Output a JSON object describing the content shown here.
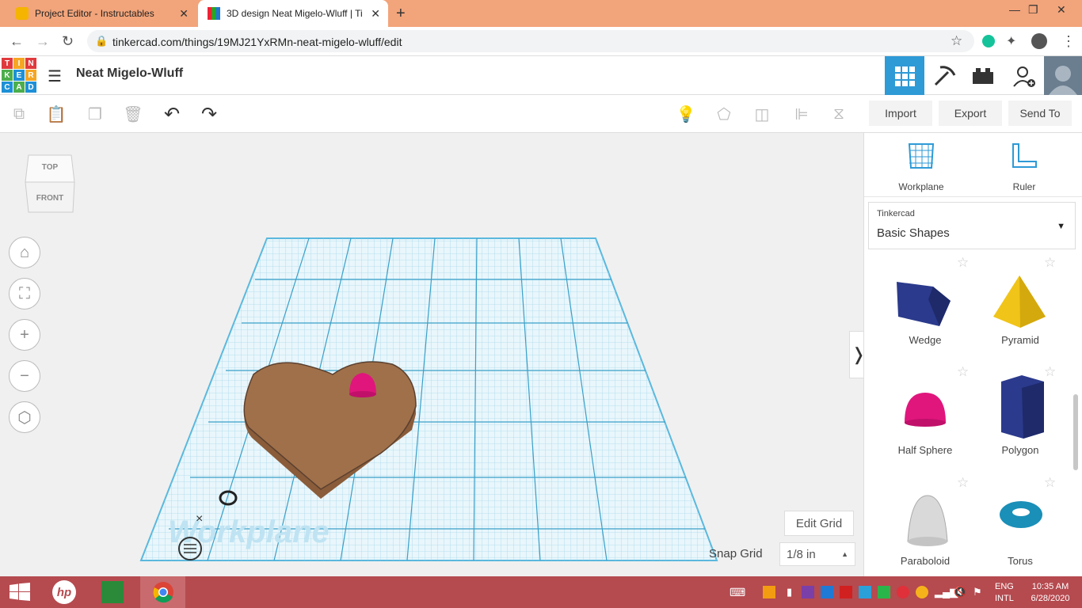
{
  "browser": {
    "tabs": [
      {
        "title": "Project Editor - Instructables",
        "active": false
      },
      {
        "title": "3D design Neat Migelo-Wluff | Ti",
        "active": true
      }
    ],
    "new_tab_icon": "plus-icon",
    "url": "tinkercad.com/things/19MJ21YxRMn-neat-migelo-wluff/edit"
  },
  "app": {
    "logo_letters": [
      "T",
      "I",
      "N",
      "K",
      "E",
      "R",
      "C",
      "A",
      "D"
    ],
    "project_name": "Neat Migelo-Wluff"
  },
  "toolbar": {
    "import_label": "Import",
    "export_label": "Export",
    "sendto_label": "Send To"
  },
  "viewcube": {
    "top": "TOP",
    "front": "FRONT"
  },
  "canvas": {
    "workplane_label": "Workplane",
    "edit_grid_label": "Edit Grid",
    "snap_grid_label": "Snap Grid",
    "snap_grid_value": "1/8 in"
  },
  "panel": {
    "workplane_label": "Workplane",
    "ruler_label": "Ruler",
    "category_small": "Tinkercad",
    "category": "Basic Shapes",
    "shapes": [
      {
        "name": "Wedge",
        "color": "#2b3a8c"
      },
      {
        "name": "Pyramid",
        "color": "#f0c419"
      },
      {
        "name": "Half Sphere",
        "color": "#e0167d"
      },
      {
        "name": "Polygon",
        "color": "#2b3a8c"
      },
      {
        "name": "Paraboloid",
        "color": "#d9d9d9"
      },
      {
        "name": "Torus",
        "color": "#1a8fb8"
      }
    ]
  },
  "taskbar": {
    "lang_top": "ENG",
    "lang_bottom": "INTL",
    "time": "10:35 AM",
    "date": "6/28/2020"
  },
  "colors": {
    "tab_bar": "#f2a47a",
    "taskbar": "#b54a4f",
    "grid": "#5ab8dd",
    "heart": "#a0704a",
    "accent": "#2e9ad6"
  }
}
